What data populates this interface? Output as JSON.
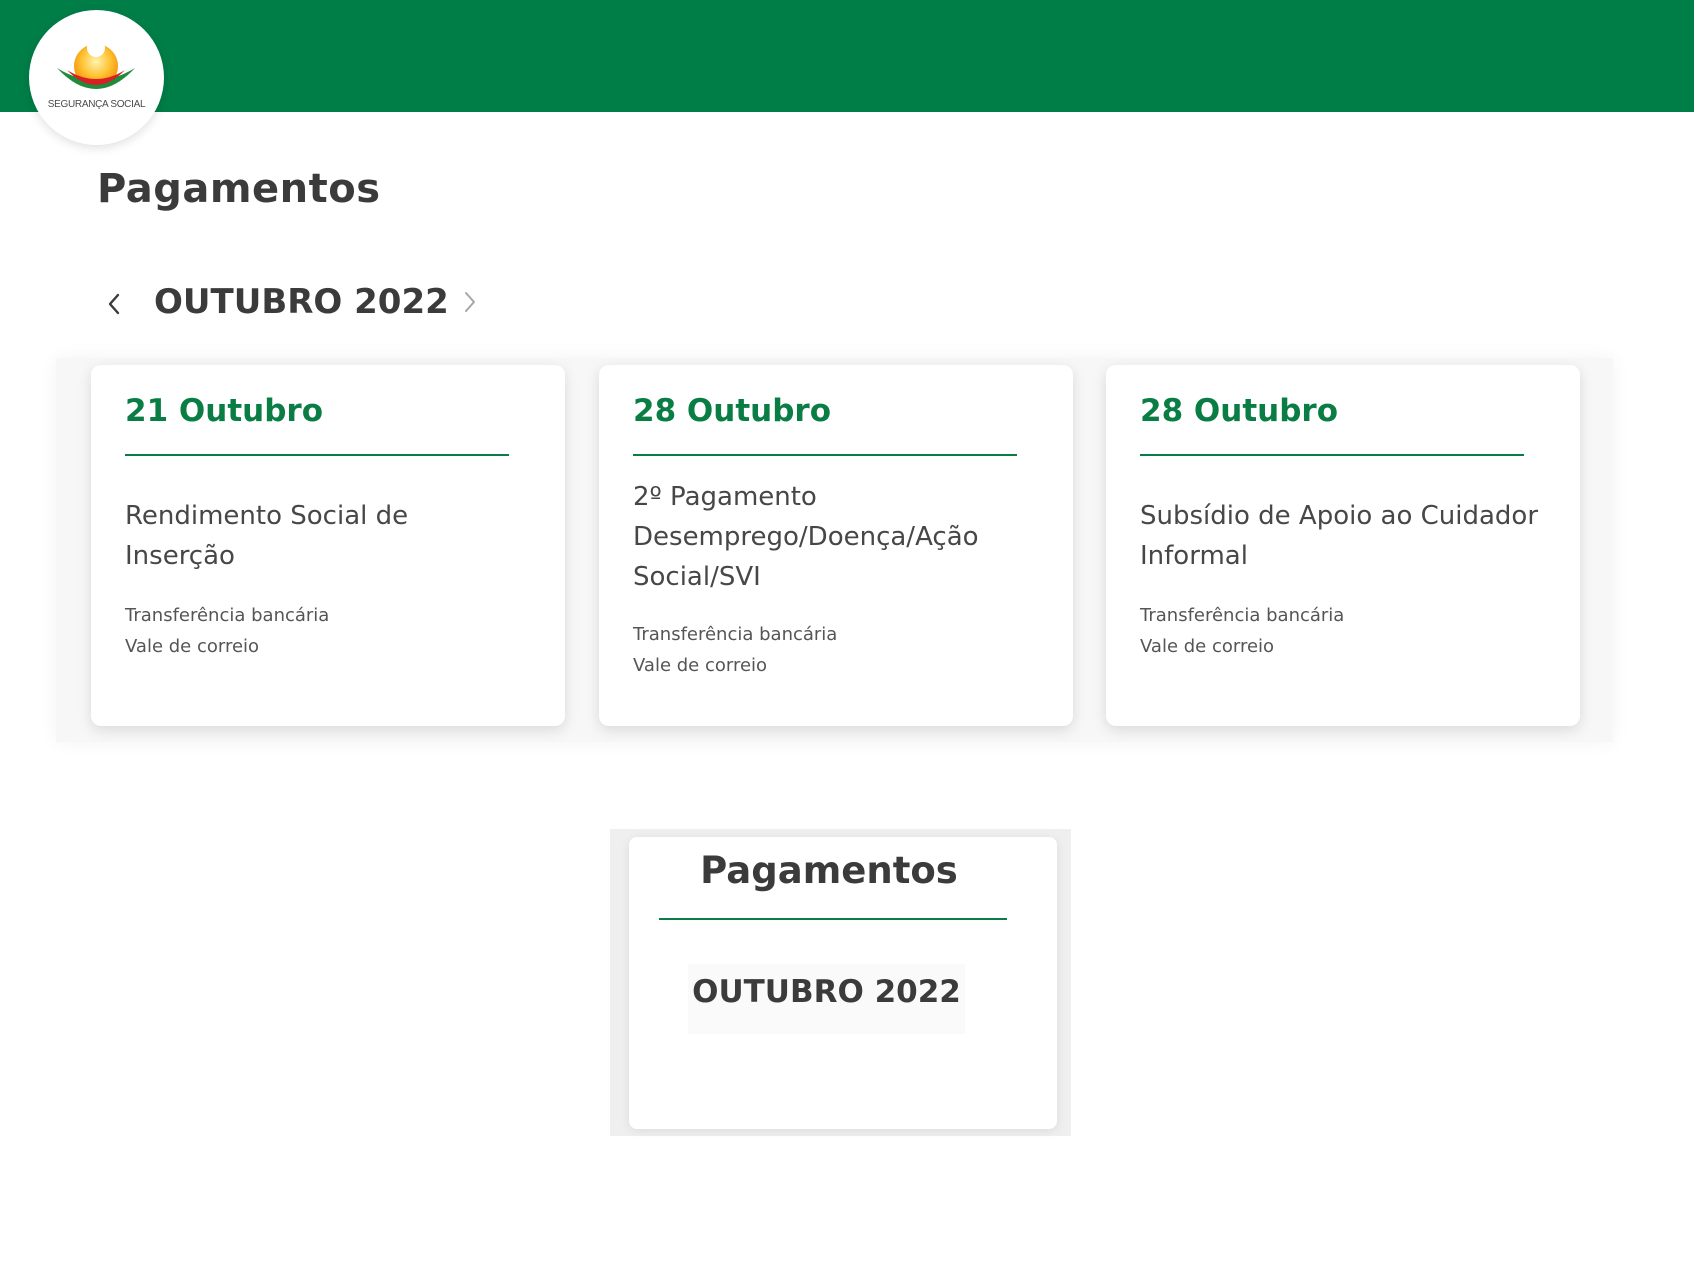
{
  "header": {
    "logo_text": "SEGURANÇA SOCIAL",
    "bar_color": "#007e47"
  },
  "page": {
    "title": "Pagamentos"
  },
  "month_nav": {
    "prev_icon": "chevron-left-icon",
    "label": "OUTUBRO 2022",
    "next_icon": "chevron-right-icon"
  },
  "cards": [
    {
      "date": "21 Outubro",
      "title": "Rendimento Social de Inserção",
      "methods": [
        "Transferência bancária",
        "Vale de correio"
      ]
    },
    {
      "date": "28 Outubro",
      "title": "2º Pagamento Desemprego/Doença/Ação Social/SVI",
      "methods": [
        "Transferência bancária",
        "Vale de correio"
      ]
    },
    {
      "date": "28 Outubro",
      "title": "Subsídio de Apoio ao Cuidador Informal",
      "methods": [
        "Transferência bancária",
        "Vale de correio"
      ]
    }
  ],
  "mini_card": {
    "title": "Pagamentos",
    "month": "OUTUBRO 2022"
  },
  "colors": {
    "accent": "#0a7d44",
    "text": "#3b3b3b"
  }
}
